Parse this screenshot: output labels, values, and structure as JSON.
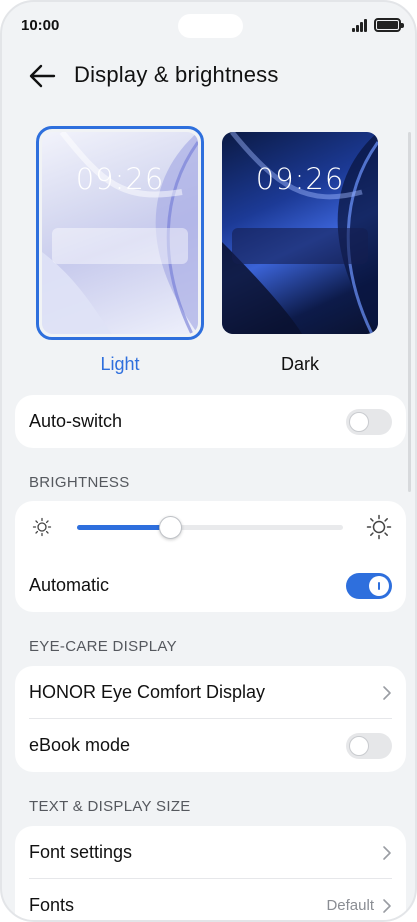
{
  "status_bar": {
    "time": "10:00"
  },
  "header": {
    "title": "Display & brightness"
  },
  "themes": {
    "light": {
      "clock": "09:26",
      "label": "Light",
      "selected": true
    },
    "dark": {
      "clock": "09:26",
      "label": "Dark",
      "selected": false
    }
  },
  "auto_switch": {
    "label": "Auto-switch",
    "enabled": false
  },
  "brightness": {
    "section_title": "BRIGHTNESS",
    "level": 0.35,
    "automatic_label": "Automatic",
    "automatic_enabled": true
  },
  "eye_care": {
    "section_title": "EYE-CARE DISPLAY",
    "eye_comfort_label": "HONOR Eye Comfort Display",
    "ebook_label": "eBook mode",
    "ebook_enabled": false
  },
  "text_display": {
    "section_title": "TEXT & DISPLAY SIZE",
    "font_settings_label": "Font settings",
    "fonts_label": "Fonts",
    "fonts_value": "Default"
  },
  "colors": {
    "accent": "#2e6fdd",
    "background": "#f1f3f5"
  }
}
